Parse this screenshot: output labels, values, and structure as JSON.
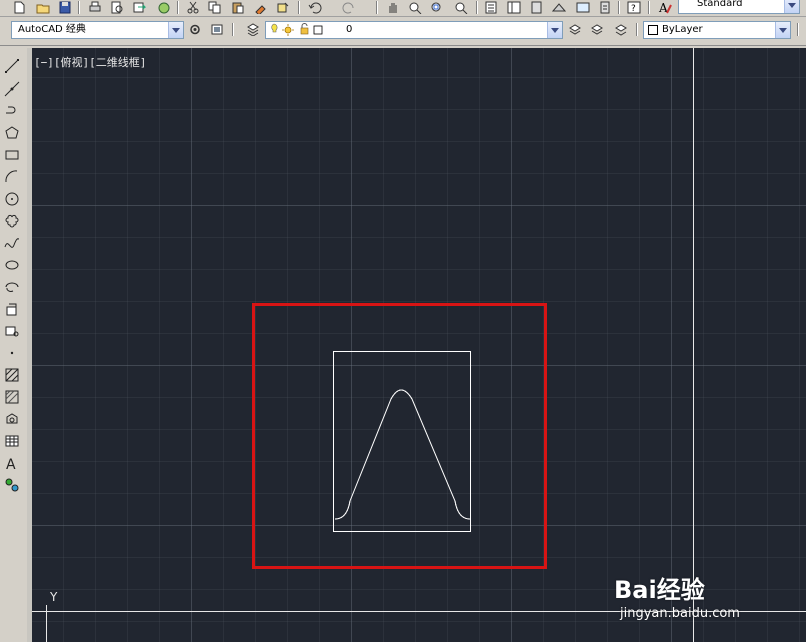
{
  "toolbar": {
    "workspace_value": "AutoCAD 经典",
    "layer_value": "0",
    "color_value": "ByLayer",
    "text_style_value": "Standard"
  },
  "viewport": {
    "label": "[−][俯视][二维线框]",
    "ucs_y_label": "Y"
  },
  "watermark": {
    "logo_text": "Bai经验",
    "url": "jingyan.baidu.com"
  },
  "colors": {
    "canvas_bg": "#212630",
    "highlight": "#d81414",
    "geometry": "#ffffff"
  },
  "icons": {
    "top": [
      "new-icon",
      "open-icon",
      "save-icon",
      "plot-icon",
      "plot-preview-icon",
      "publish-icon",
      "3d-dwf-icon",
      "cut-icon",
      "copy-icon",
      "paste-icon",
      "match-properties-icon",
      "block-editor-icon",
      "undo-icon",
      "redo-icon",
      "pan-icon",
      "zoom-realtime-icon",
      "zoom-window-icon",
      "zoom-previous-icon",
      "properties-icon",
      "design-center-icon",
      "tool-palettes-icon",
      "sheet-set-icon",
      "markup-icon",
      "calculator-icon",
      "help-icon",
      "text-style-icon"
    ],
    "left": [
      "line-icon",
      "construction-line-icon",
      "polyline-icon",
      "polygon-icon",
      "rectangle-icon",
      "arc-icon",
      "circle-icon",
      "revision-cloud-icon",
      "spline-icon",
      "ellipse-icon",
      "ellipse-arc-icon",
      "insert-block-icon",
      "make-block-icon",
      "point-icon",
      "hatch-icon",
      "gradient-icon",
      "region-icon",
      "table-icon",
      "multiline-text-icon",
      "add-selected-icon"
    ]
  }
}
